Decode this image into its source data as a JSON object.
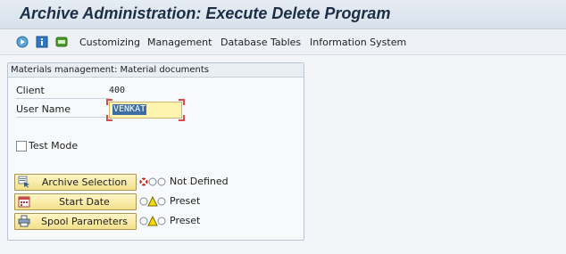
{
  "window": {
    "title": "Archive Administration: Execute Delete Program"
  },
  "toolbar": {
    "icons": [
      "execute-icon",
      "info-icon",
      "job-icon"
    ],
    "menu": [
      "Customizing",
      "Management",
      "Database Tables",
      "Information System"
    ]
  },
  "group": {
    "title": "Materials management: Material documents",
    "client_label": "Client",
    "client_value": "400",
    "user_label": "User Name",
    "user_value": "VENKAT",
    "test_mode_label": "Test Mode",
    "test_mode_checked": false
  },
  "actions": [
    {
      "label": "Archive Selection",
      "icon": "archive-selection-icon",
      "status": "Not Defined",
      "light": "red"
    },
    {
      "label": "Start Date",
      "icon": "calendar-icon",
      "status": "Preset",
      "light": "yellow"
    },
    {
      "label": "Spool Parameters",
      "icon": "printer-icon",
      "status": "Preset",
      "light": "yellow"
    }
  ],
  "colors": {
    "title_text": "#1c2e44",
    "button_fill": "#f2e08a",
    "input_highlight": "#fff3b0",
    "selection": "#3b6ea5",
    "light_red": "#e53935",
    "light_yellow": "#f5d90a"
  }
}
